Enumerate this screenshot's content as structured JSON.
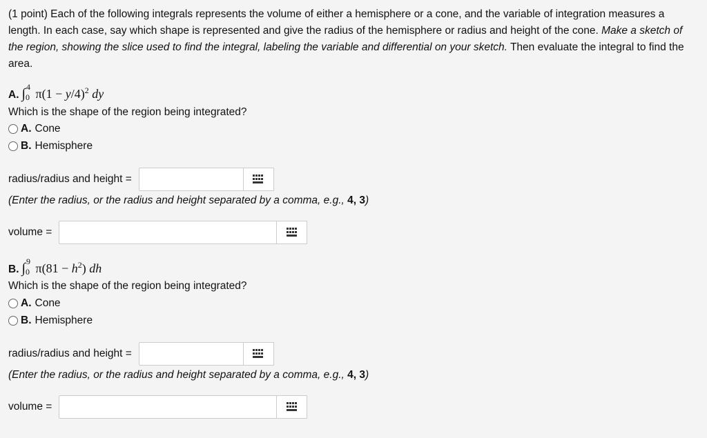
{
  "intro": {
    "text": "(1 point) Each of the following integrals represents the volume of either a hemisphere or a cone, and the variable of integration measures a length. In each case, say which shape is represented and give the radius of the hemisphere or radius and height of the cone. ",
    "italic": "Make a sketch of the region, showing the slice used to find the integral, labeling the variable and differential on your sketch.",
    "closing": " Then evaluate the integral to find the area."
  },
  "parts": [
    {
      "label": "A.",
      "lower": "0",
      "upper": "4",
      "integrand": "π(1 − y/4)² dy",
      "question": "Which is the shape of the region being integrated?",
      "options": [
        {
          "letter": "A.",
          "text": "Cone",
          "selected": false
        },
        {
          "letter": "B.",
          "text": "Hemisphere",
          "selected": false
        }
      ],
      "radius_label": "radius/radius and height =",
      "radius_value": "",
      "hint": "(Enter the radius, or the radius and height separated by a comma, e.g., ",
      "hint_example": "4, 3",
      "hint_close": ")",
      "volume_label": "volume =",
      "volume_value": ""
    },
    {
      "label": "B.",
      "lower": "0",
      "upper": "9",
      "integrand": "π(81 − h²) dh",
      "question": "Which is the shape of the region being integrated?",
      "options": [
        {
          "letter": "A.",
          "text": "Cone",
          "selected": false
        },
        {
          "letter": "B.",
          "text": "Hemisphere",
          "selected": false
        }
      ],
      "radius_label": "radius/radius and height =",
      "radius_value": "",
      "hint": "(Enter the radius, or the radius and height separated by a comma, e.g., ",
      "hint_example": "4, 3",
      "hint_close": ")",
      "volume_label": "volume =",
      "volume_value": ""
    }
  ],
  "icons": {
    "keypad": "keypad-icon",
    "radio": "radio-button"
  },
  "colors": {
    "background": "#f4f4f4",
    "field_border": "#cccccc",
    "text": "#111111"
  }
}
